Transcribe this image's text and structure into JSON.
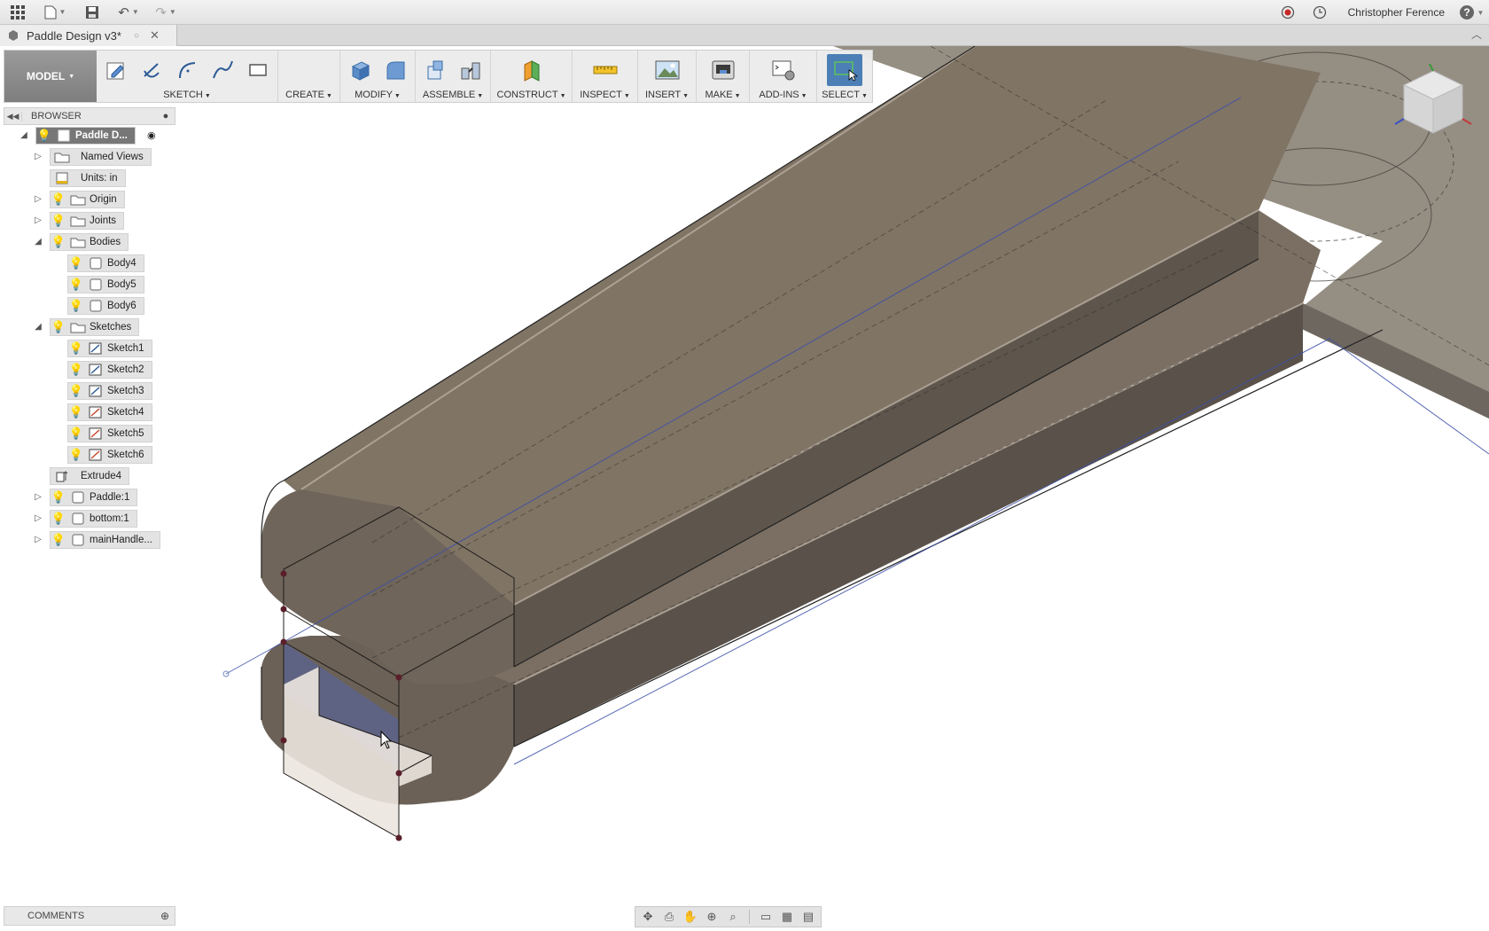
{
  "appbar": {
    "user_name": "Christopher Ference"
  },
  "tab": {
    "title": "Paddle Design v3*"
  },
  "toolbar": {
    "workspace": "MODEL",
    "groups": [
      {
        "label": "SKETCH"
      },
      {
        "label": "CREATE"
      },
      {
        "label": "MODIFY"
      },
      {
        "label": "ASSEMBLE"
      },
      {
        "label": "CONSTRUCT"
      },
      {
        "label": "INSPECT"
      },
      {
        "label": "INSERT"
      },
      {
        "label": "MAKE"
      },
      {
        "label": "ADD-INS"
      },
      {
        "label": "SELECT"
      }
    ]
  },
  "browser": {
    "title": "BROWSER",
    "items": [
      {
        "label": "Paddle D..."
      },
      {
        "label": "Named Views"
      },
      {
        "label": "Units: in"
      },
      {
        "label": "Origin"
      },
      {
        "label": "Joints"
      },
      {
        "label": "Bodies"
      },
      {
        "label": "Body4"
      },
      {
        "label": "Body5"
      },
      {
        "label": "Body6"
      },
      {
        "label": "Sketches"
      },
      {
        "label": "Sketch1"
      },
      {
        "label": "Sketch2"
      },
      {
        "label": "Sketch3"
      },
      {
        "label": "Sketch4"
      },
      {
        "label": "Sketch5"
      },
      {
        "label": "Sketch6"
      },
      {
        "label": "Extrude4"
      },
      {
        "label": "Paddle:1"
      },
      {
        "label": "bottom:1"
      },
      {
        "label": "mainHandle..."
      }
    ]
  },
  "comments": {
    "title": "COMMENTS"
  },
  "colors": {
    "body_top": "#7f7364",
    "body_side": "#5d544b",
    "selection_blue": "#5566a8",
    "accent": "#4b7fb6"
  }
}
